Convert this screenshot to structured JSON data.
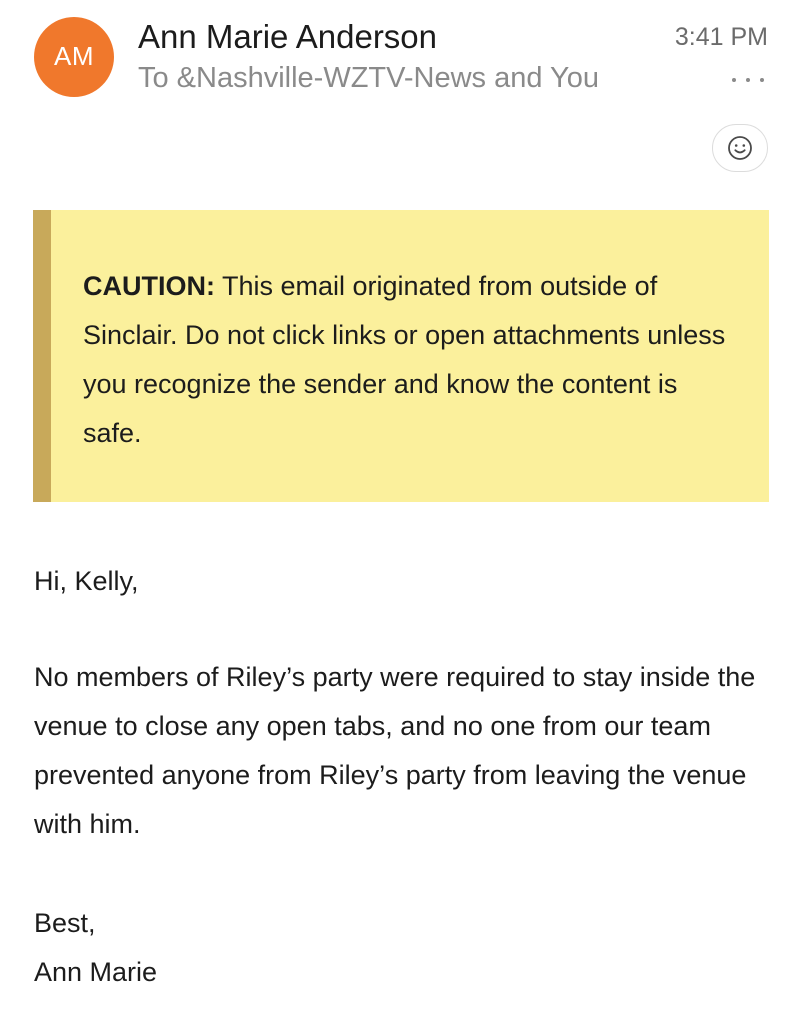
{
  "header": {
    "avatar_initials": "AM",
    "avatar_color": "#f0782c",
    "sender_name": "Ann Marie Anderson",
    "recipients": "To &Nashville-WZTV-News and You",
    "time": "3:41 PM",
    "more_icon": "more-horizontal-icon",
    "reaction_icon": "smiley-icon"
  },
  "caution": {
    "label": "CAUTION:",
    "text": " This email originated from outside of Sinclair. Do not click links or open attachments unless you recognize the sender and know the content is safe.",
    "background_color": "#fbf09c",
    "bar_color": "#c8a95a"
  },
  "body": {
    "greeting": "Hi, Kelly,",
    "paragraph": "No members of Riley’s party were required to stay inside the venue to close any open tabs, and no one from our team prevented anyone from Riley’s party from leaving the venue with him.",
    "closing": "Best,",
    "signature": "Ann Marie"
  }
}
